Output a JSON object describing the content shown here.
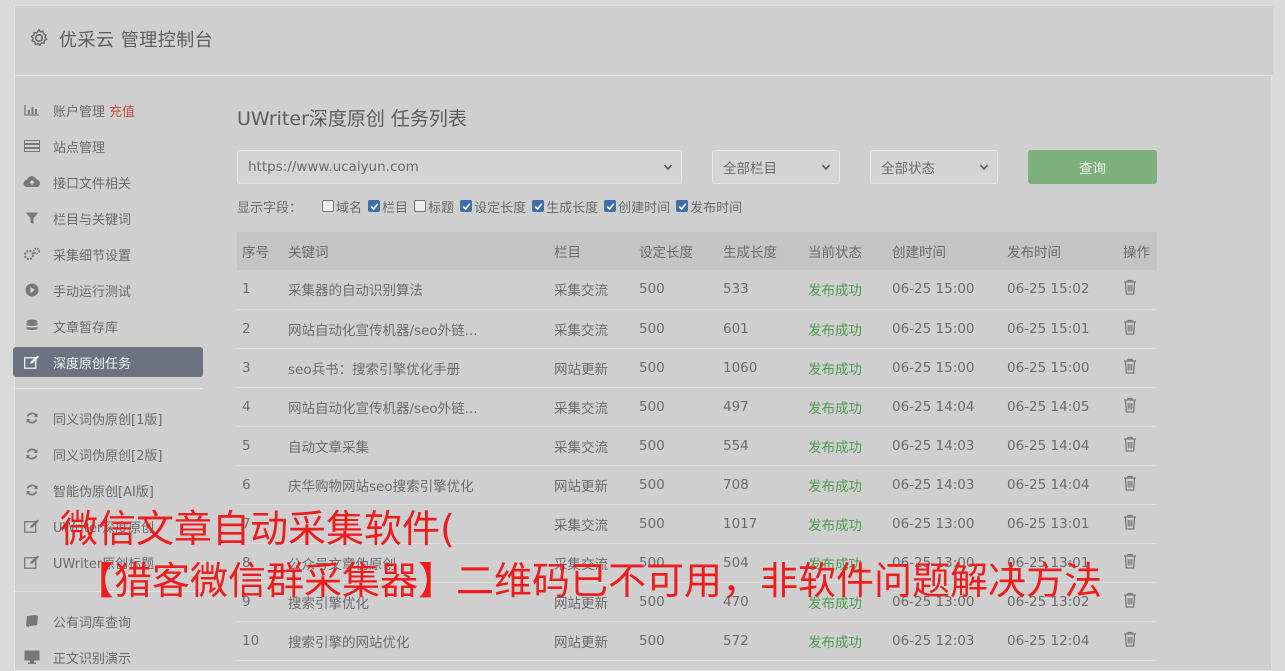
{
  "app": {
    "title": "优采云 管理控制台"
  },
  "sidebar": {
    "groups": [
      [
        {
          "label": "账户管理",
          "badge": "充值",
          "icon": "bar-chart-icon"
        },
        {
          "label": "站点管理",
          "icon": "server-icon"
        },
        {
          "label": "接口文件相关",
          "icon": "cloud-upload-icon"
        },
        {
          "label": "栏目与关键词",
          "icon": "filter-icon"
        },
        {
          "label": "采集细节设置",
          "icon": "cogs-icon"
        },
        {
          "label": "手动运行测试",
          "icon": "play-icon"
        },
        {
          "label": "文章暂存库",
          "icon": "database-icon"
        },
        {
          "label": "深度原创任务",
          "icon": "edit-icon",
          "active": true
        }
      ],
      [
        {
          "label": "同义词伪原创[1版]",
          "icon": "refresh-icon"
        },
        {
          "label": "同义词伪原创[2版]",
          "icon": "refresh-icon"
        },
        {
          "label": "智能伪原创[AI版]",
          "icon": "refresh-icon"
        },
        {
          "label": "UWriter深度原创",
          "icon": "edit-icon"
        },
        {
          "label": "UWriter原创标题",
          "icon": "edit-icon"
        }
      ],
      [
        {
          "label": "公有词库查询",
          "icon": "book-icon"
        },
        {
          "label": "正文识别演示",
          "icon": "desktop-icon"
        }
      ]
    ]
  },
  "main": {
    "title": "UWriter深度原创 任务列表",
    "filters": {
      "site": "https://www.ucaiyun.com",
      "column": "全部栏目",
      "status": "全部状态",
      "query_label": "查询"
    },
    "fields": {
      "label": "显示字段：",
      "items": [
        {
          "label": "域名",
          "checked": false
        },
        {
          "label": "栏目",
          "checked": true
        },
        {
          "label": "标题",
          "checked": false
        },
        {
          "label": "设定长度",
          "checked": true
        },
        {
          "label": "生成长度",
          "checked": true
        },
        {
          "label": "创建时间",
          "checked": true
        },
        {
          "label": "发布时间",
          "checked": true
        }
      ]
    },
    "table": {
      "headers": [
        "序号",
        "关键词",
        "栏目",
        "设定长度",
        "生成长度",
        "当前状态",
        "创建时间",
        "发布时间",
        "操作"
      ],
      "rows": [
        [
          "1",
          "采集器的自动识别算法",
          "采集交流",
          "500",
          "533",
          "发布成功",
          "06-25 15:00",
          "06-25 15:02"
        ],
        [
          "2",
          "网站自动化宣传机器/seo外链...",
          "采集交流",
          "500",
          "601",
          "发布成功",
          "06-25 15:00",
          "06-25 15:01"
        ],
        [
          "3",
          "seo兵书：搜索引擎优化手册",
          "网站更新",
          "500",
          "1060",
          "发布成功",
          "06-25 15:00",
          "06-25 15:00"
        ],
        [
          "4",
          "网站自动化宣传机器/seo外链...",
          "采集交流",
          "500",
          "497",
          "发布成功",
          "06-25 14:04",
          "06-25 14:05"
        ],
        [
          "5",
          "自动文章采集",
          "采集交流",
          "500",
          "554",
          "发布成功",
          "06-25 14:03",
          "06-25 14:04"
        ],
        [
          "6",
          "庆华购物网站seo搜索引擎优化",
          "网站更新",
          "500",
          "708",
          "发布成功",
          "06-25 14:03",
          "06-25 14:04"
        ],
        [
          "7",
          "",
          "采集交流",
          "500",
          "1017",
          "发布成功",
          "06-25 13:00",
          "06-25 13:01"
        ],
        [
          "8",
          "公众号文章伪原创",
          "采集交流",
          "500",
          "504",
          "发布成功",
          "06-25 13:00",
          "06-25 13:01"
        ],
        [
          "9",
          "搜索引擎优化",
          "网站更新",
          "500",
          "470",
          "发布成功",
          "06-25 13:00",
          "06-25 13:02"
        ],
        [
          "10",
          "搜索引擎的网站优化",
          "网站更新",
          "500",
          "572",
          "发布成功",
          "06-25 12:03",
          "06-25 12:04"
        ]
      ]
    }
  },
  "overlay": {
    "line1": "微信文章自动采集软件(",
    "line2": "【猎客微信群采集器】二维码已不可用，非软件问题解决方法"
  },
  "colors": {
    "accent_green": "#7db07d",
    "status_ok": "#4e9a4e",
    "badge_red": "#c84b3b",
    "overlay_red": "#ee1c1c"
  }
}
